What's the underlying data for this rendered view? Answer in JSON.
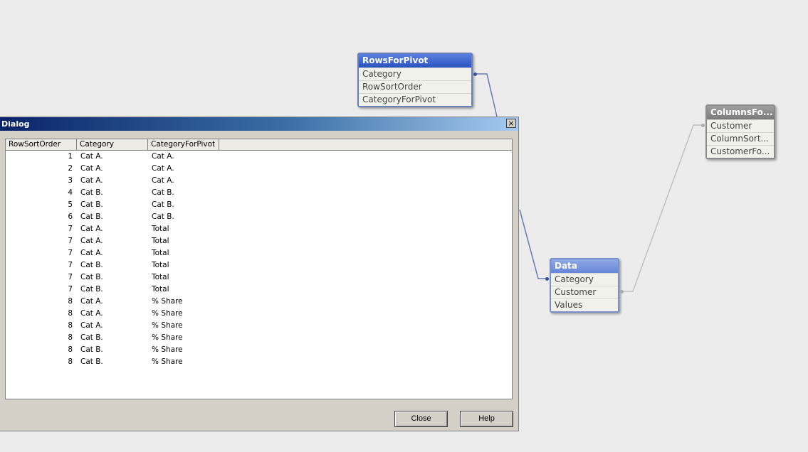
{
  "tables": {
    "rows_for_pivot": {
      "title": "RowsForPivot",
      "fields": [
        "Category",
        "RowSortOrder",
        "CategoryForPivot"
      ]
    },
    "data": {
      "title": "Data",
      "fields": [
        "Category",
        "Customer",
        "Values"
      ]
    },
    "columns_for_pivot": {
      "title": "ColumnsFo...",
      "fields": [
        "Customer",
        "ColumnSort...",
        "CustomerFo..."
      ]
    }
  },
  "colors": {
    "link_line": "#6a7ab0",
    "dialog_title_start": "#0a246a",
    "dialog_title_end": "#a6caf0"
  },
  "dialog": {
    "title": "Dialog",
    "close_glyph": "×",
    "columns": [
      "RowSortOrder",
      "Category",
      "CategoryForPivot"
    ],
    "rows": [
      [
        "1",
        "Cat A.",
        "Cat A."
      ],
      [
        "2",
        "Cat A.",
        "Cat A."
      ],
      [
        "3",
        "Cat A.",
        "Cat A."
      ],
      [
        "4",
        "Cat B.",
        "Cat B."
      ],
      [
        "5",
        "Cat B.",
        "Cat B."
      ],
      [
        "6",
        "Cat B.",
        "Cat B."
      ],
      [
        "7",
        "Cat A.",
        "Total"
      ],
      [
        "7",
        "Cat A.",
        "Total"
      ],
      [
        "7",
        "Cat A.",
        "Total"
      ],
      [
        "7",
        "Cat B.",
        "Total"
      ],
      [
        "7",
        "Cat B.",
        "Total"
      ],
      [
        "7",
        "Cat B.",
        "Total"
      ],
      [
        "8",
        "Cat A.",
        "% Share"
      ],
      [
        "8",
        "Cat A.",
        "% Share"
      ],
      [
        "8",
        "Cat A.",
        "% Share"
      ],
      [
        "8",
        "Cat B.",
        "% Share"
      ],
      [
        "8",
        "Cat B.",
        "% Share"
      ],
      [
        "8",
        "Cat B.",
        "% Share"
      ]
    ],
    "close_label": "Close",
    "help_label": "Help"
  }
}
